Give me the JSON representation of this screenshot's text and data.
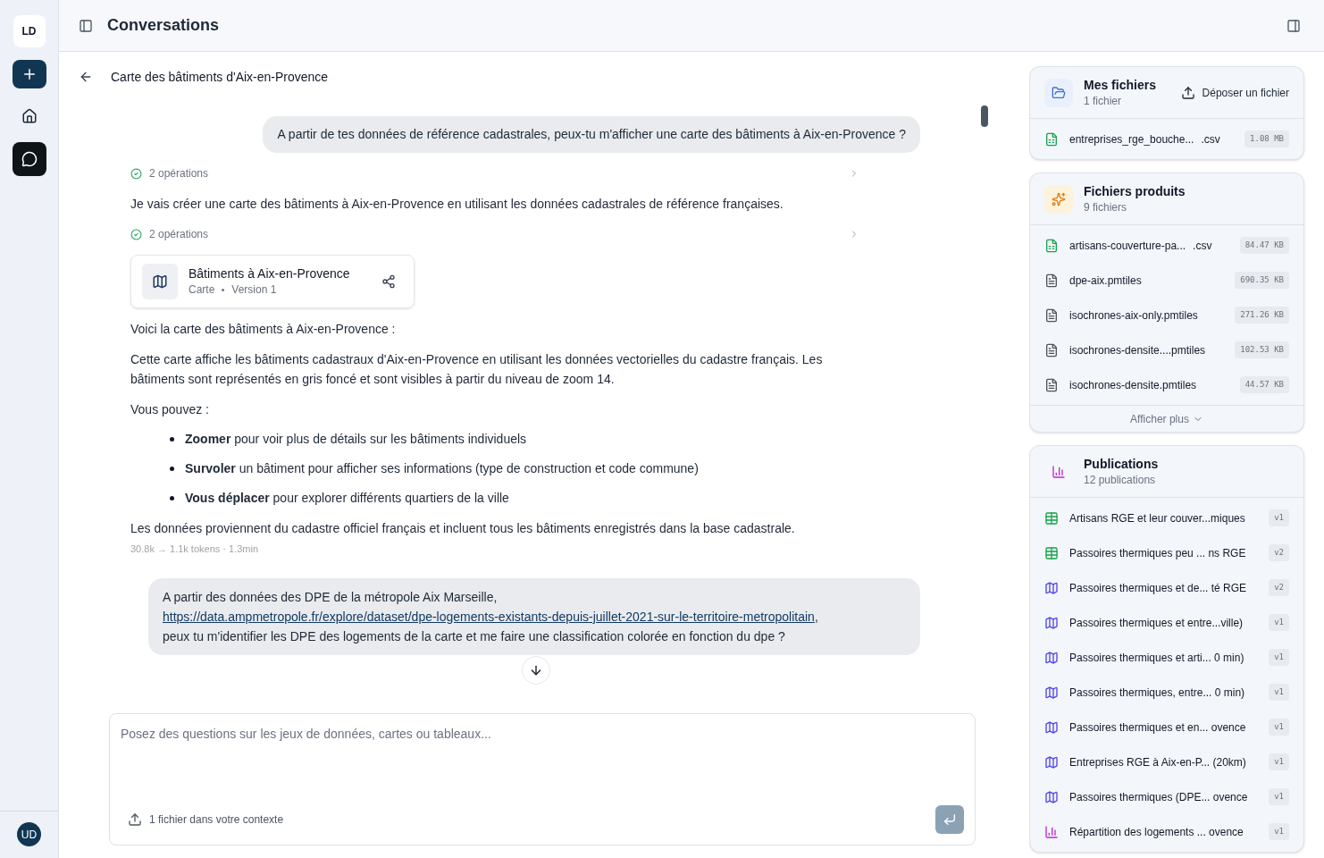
{
  "sidebar": {
    "workspace": "LD",
    "nav": [
      {
        "kind": "home",
        "selected": false
      },
      {
        "kind": "chat",
        "selected": true
      }
    ],
    "user": "UD"
  },
  "header": {
    "title": "Conversations"
  },
  "conversation": {
    "title": "Carte des bâtiments d'Aix-en-Provence",
    "messages": [
      {
        "kind": "user",
        "text": "A partir de tes données de référence cadastrales, peux-tu m'afficher une carte des bâtiments à Aix-en-Provence ?"
      },
      {
        "kind": "operations",
        "text": "2 opérations"
      },
      {
        "kind": "text",
        "text": "Je vais créer une carte des bâtiments à Aix-en-Provence en utilisant les données cadastrales de référence françaises."
      },
      {
        "kind": "operations",
        "text": "2 opérations"
      },
      {
        "kind": "artifact",
        "title": "Bâtiments à Aix-en-Provence",
        "type": "Carte",
        "version": "Version 1"
      },
      {
        "kind": "text",
        "text": "Voici la carte des bâtiments à Aix-en-Provence :"
      },
      {
        "kind": "text",
        "text": "Cette carte affiche les bâtiments cadastraux d'Aix-en-Provence en utilisant les données vectorielles du cadastre français. Les bâtiments sont représentés en gris foncé et sont visibles à partir du niveau de zoom 14."
      },
      {
        "kind": "text",
        "text": "Vous pouvez :"
      },
      {
        "kind": "list",
        "items": [
          "**Zoomer** pour voir plus de détails sur les bâtiments individuels",
          "**Survoler** un bâtiment pour afficher ses informations (type de construction et code commune)",
          "**Vous déplacer** pour explorer différents quartiers de la ville"
        ]
      },
      {
        "kind": "text",
        "text": "Les données proviennent du cadastre officiel français et incluent tous les bâtiments enregistrés dans la base cadastrale."
      },
      {
        "kind": "meta",
        "text": "30.8k → 1.1k tokens · 1.3min"
      },
      {
        "kind": "user_link",
        "before": "A partir des données des DPE de la métropole Aix Marseille,",
        "link": "https://data.ampmetropole.fr/explore/dataset/dpe-logements-existants-depuis-juillet-2021-sur-le-territoire-metropolitain",
        "link_punct": ",",
        "after": "peux tu m'identifier les DPE des logements de la carte et me faire une classification colorée en fonction du dpe ?"
      }
    ]
  },
  "composer": {
    "placeholder": "Posez des questions sur les jeux de données, cartes ou tableaux...",
    "context": "1 fichier dans votre contexte"
  },
  "panels": [
    {
      "kind": "folder",
      "title": "Mes fichiers",
      "subtitle": "1 fichier",
      "action": "Déposer un fichier",
      "items": [
        {
          "kind": "csv",
          "name": "entreprises_rge_bouche...",
          "ext": ".csv",
          "size": "1.08 MB"
        }
      ]
    },
    {
      "kind": "sparkle",
      "title": "Fichiers produits",
      "subtitle": "9 fichiers",
      "footer": "Afficher plus",
      "items": [
        {
          "kind": "csv",
          "name": "artisans-couverture-pa...",
          "ext": ".csv",
          "size": "84.47 KB"
        },
        {
          "kind": "file",
          "name": "dpe-aix.pmtiles",
          "size": "690.35 KB"
        },
        {
          "kind": "file",
          "name": "isochrones-aix-only.pmtiles",
          "size": "271.26 KB"
        },
        {
          "kind": "file",
          "name": "isochrones-densite....pmtiles",
          "size": "102.53 KB"
        },
        {
          "kind": "file",
          "name": "isochrones-densite.pmtiles",
          "size": "44.57 KB"
        }
      ]
    },
    {
      "kind": "chart",
      "title": "Publications",
      "subtitle": "12 publications",
      "items": [
        {
          "kind": "table",
          "name": "Artisans RGE et leur couver...miques",
          "size": "v1"
        },
        {
          "kind": "table",
          "name": "Passoires thermiques peu ...  ns RGE",
          "size": "v2"
        },
        {
          "kind": "map",
          "name": "Passoires thermiques et de...  té RGE",
          "size": "v2"
        },
        {
          "kind": "map",
          "name": "Passoires thermiques et entre...ville)",
          "size": "v1"
        },
        {
          "kind": "map",
          "name": "Passoires thermiques et arti... 0 min)",
          "size": "v1"
        },
        {
          "kind": "map",
          "name": "Passoires thermiques, entre... 0 min)",
          "size": "v1"
        },
        {
          "kind": "map",
          "name": "Passoires thermiques et en... ovence",
          "size": "v1"
        },
        {
          "kind": "map",
          "name": "Entreprises RGE à Aix-en-P... (20km)",
          "size": "v1"
        },
        {
          "kind": "map",
          "name": "Passoires thermiques (DPE... ovence",
          "size": "v1"
        },
        {
          "kind": "chart",
          "name": "Répartition des logements ... ovence",
          "size": "v1"
        }
      ]
    }
  ]
}
